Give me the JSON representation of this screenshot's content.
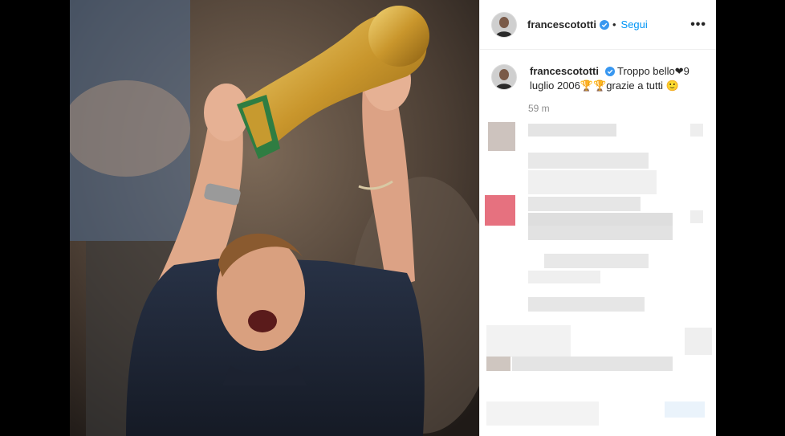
{
  "post": {
    "username": "francescototti",
    "follow_label": "Segui",
    "separator": "•",
    "more_label": "•••",
    "caption_text": "Troppo bello❤9 luglio 2006🏆🏆grazie a tutti 🙂",
    "timestamp": "59 m"
  },
  "colors": {
    "link_blue": "#0095f6",
    "verified_blue": "#3897f0",
    "text_dark": "#262626",
    "text_muted": "#8e8e8e"
  },
  "icons": {
    "verified": "verified-badge-icon",
    "more": "more-options-icon"
  }
}
